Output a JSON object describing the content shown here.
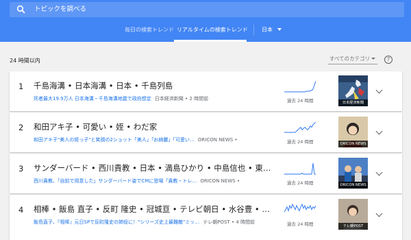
{
  "search": {
    "placeholder": "トピックを調べる"
  },
  "nav": {
    "tabs": [
      {
        "label": "毎日の検索トレンド",
        "active": false
      },
      {
        "label": "リアルタイムの検索トレンド",
        "active": true
      }
    ],
    "country": "日本"
  },
  "filters": {
    "time_range": "24 時間以内",
    "category": "すべてのカテゴリ"
  },
  "colors": {
    "header": "#4285f4",
    "link": "#1a73e8",
    "spark": "#4285f4"
  },
  "trends": [
    {
      "rank": "1",
      "title": "千島海溝 • 日本海溝 • 日本 • 千島列島",
      "headline": "死者最大19.9万人 日本海溝・千島海溝地震で政府想定",
      "source": "日本経済新聞 • 2 時間前",
      "spark_label": "過去 24 時間",
      "thumb_caption": "日本経済新聞",
      "spark_values": [
        1,
        1,
        1,
        1,
        1,
        1,
        1,
        1,
        1,
        1,
        1,
        1,
        1,
        1,
        1,
        2,
        2,
        2,
        3,
        4,
        10,
        16
      ]
    },
    {
      "rank": "2",
      "title": "和田アキ子 • 可愛い • 姪 • わだ家",
      "headline": "和田アキ子\"美人の姪っ子\"と笑顔の2ショット「美人」「お綺麗」「可愛い…",
      "source": "ORICON NEWS •",
      "spark_label": "過去 24 時間",
      "thumb_caption": "ORICON NEWS",
      "spark_values": [
        1,
        1,
        1,
        1,
        1,
        1,
        1,
        1,
        1,
        2,
        3,
        4,
        5,
        3,
        4,
        5,
        4,
        3,
        4,
        6,
        5,
        7,
        8,
        9
      ]
    },
    {
      "rank": "3",
      "title": "サンダーバード • 西川貴教 • 日本 • 満島ひかり • 中島信也 • 東北...",
      "headline": "西川貴教、「自前で用意した」サンダーバード姿でCMに登場「貴教・トレ…",
      "source": "ORICON NEWS •",
      "spark_label": "過去 24 時間",
      "thumb_caption": "ORICON NEWS",
      "spark_values": [
        1,
        1,
        1,
        1,
        1,
        1,
        1,
        1,
        1,
        1,
        1,
        1,
        1,
        2,
        1,
        1,
        1,
        1,
        1,
        1,
        1,
        15,
        1,
        1
      ]
    },
    {
      "rank": "4",
      "title": "相棒 • 飯島 直子 • 反町 隆史 • 冠城亘 • テレビ朝日 • 水谷豊 • 元日 •",
      "headline": "飯島直子、『相棒』元日SPで反町隆史の姉役に！\"シリーズ史上最難敵\"ミッ…",
      "source": "テレ朝POST • 4 時間前",
      "spark_label": "過去 24 時間",
      "thumb_caption": "テレ朝POST",
      "spark_values": [
        3,
        5,
        7,
        4,
        8,
        6,
        9,
        7,
        5,
        8,
        6,
        4,
        7,
        9,
        6,
        8,
        5,
        7,
        6,
        8,
        5,
        7,
        6,
        8
      ]
    }
  ]
}
